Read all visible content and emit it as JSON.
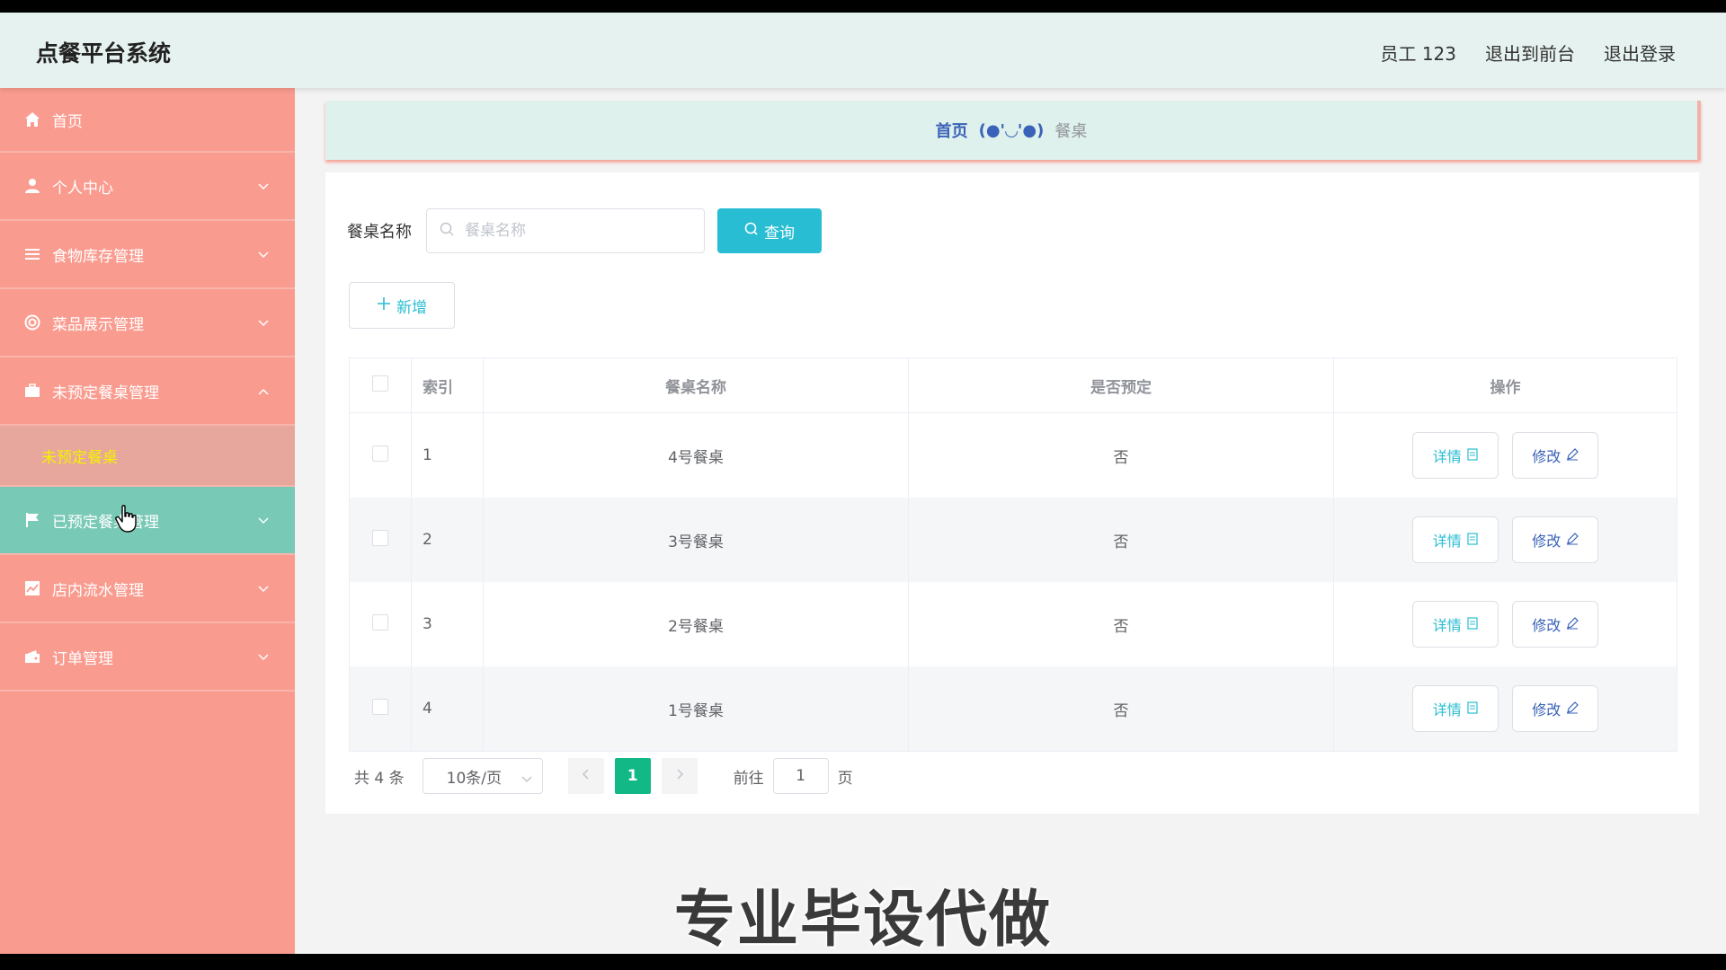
{
  "header": {
    "title": "点餐平台系统",
    "user": "员工 123",
    "to_front": "退出到前台",
    "logout": "退出登录"
  },
  "sidebar": {
    "items": [
      {
        "label": "首页",
        "icon": "home-icon"
      },
      {
        "label": "个人中心",
        "icon": "user-icon"
      },
      {
        "label": "食物库存管理",
        "icon": "list-icon"
      },
      {
        "label": "菜品展示管理",
        "icon": "lifebuoy-icon"
      },
      {
        "label": "未预定餐桌管理",
        "icon": "briefcase-icon"
      },
      {
        "label": "已预定餐桌管理",
        "icon": "flag-icon"
      },
      {
        "label": "店内流水管理",
        "icon": "chart-icon"
      },
      {
        "label": "订单管理",
        "icon": "wallet-icon"
      }
    ],
    "sub_item": "未预定餐桌"
  },
  "breadcrumb": {
    "home": "首页",
    "separator": "(●'◡'●)",
    "current": "餐桌"
  },
  "search": {
    "label": "餐桌名称",
    "placeholder": "餐桌名称",
    "button": "查询"
  },
  "add_button": "新增",
  "table": {
    "headers": [
      "索引",
      "餐桌名称",
      "是否预定",
      "操作"
    ],
    "rows": [
      {
        "index": "1",
        "name": "4号餐桌",
        "booked": "否"
      },
      {
        "index": "2",
        "name": "3号餐桌",
        "booked": "否"
      },
      {
        "index": "3",
        "name": "2号餐桌",
        "booked": "否"
      },
      {
        "index": "4",
        "name": "1号餐桌",
        "booked": "否"
      }
    ],
    "detail_label": "详情",
    "edit_label": "修改"
  },
  "pagination": {
    "total": "共 4 条",
    "page_size": "10条/页",
    "current_page": "1",
    "goto_label": "前往",
    "goto_value": "1",
    "page_suffix": "页"
  },
  "watermark": "专业毕设代做",
  "colors": {
    "sidebar_bg": "#fa9b8f",
    "active_item": "#78c9b6",
    "header_bg": "#e6f2ef",
    "accent": "#29bdd3",
    "page_active": "#12b886"
  }
}
